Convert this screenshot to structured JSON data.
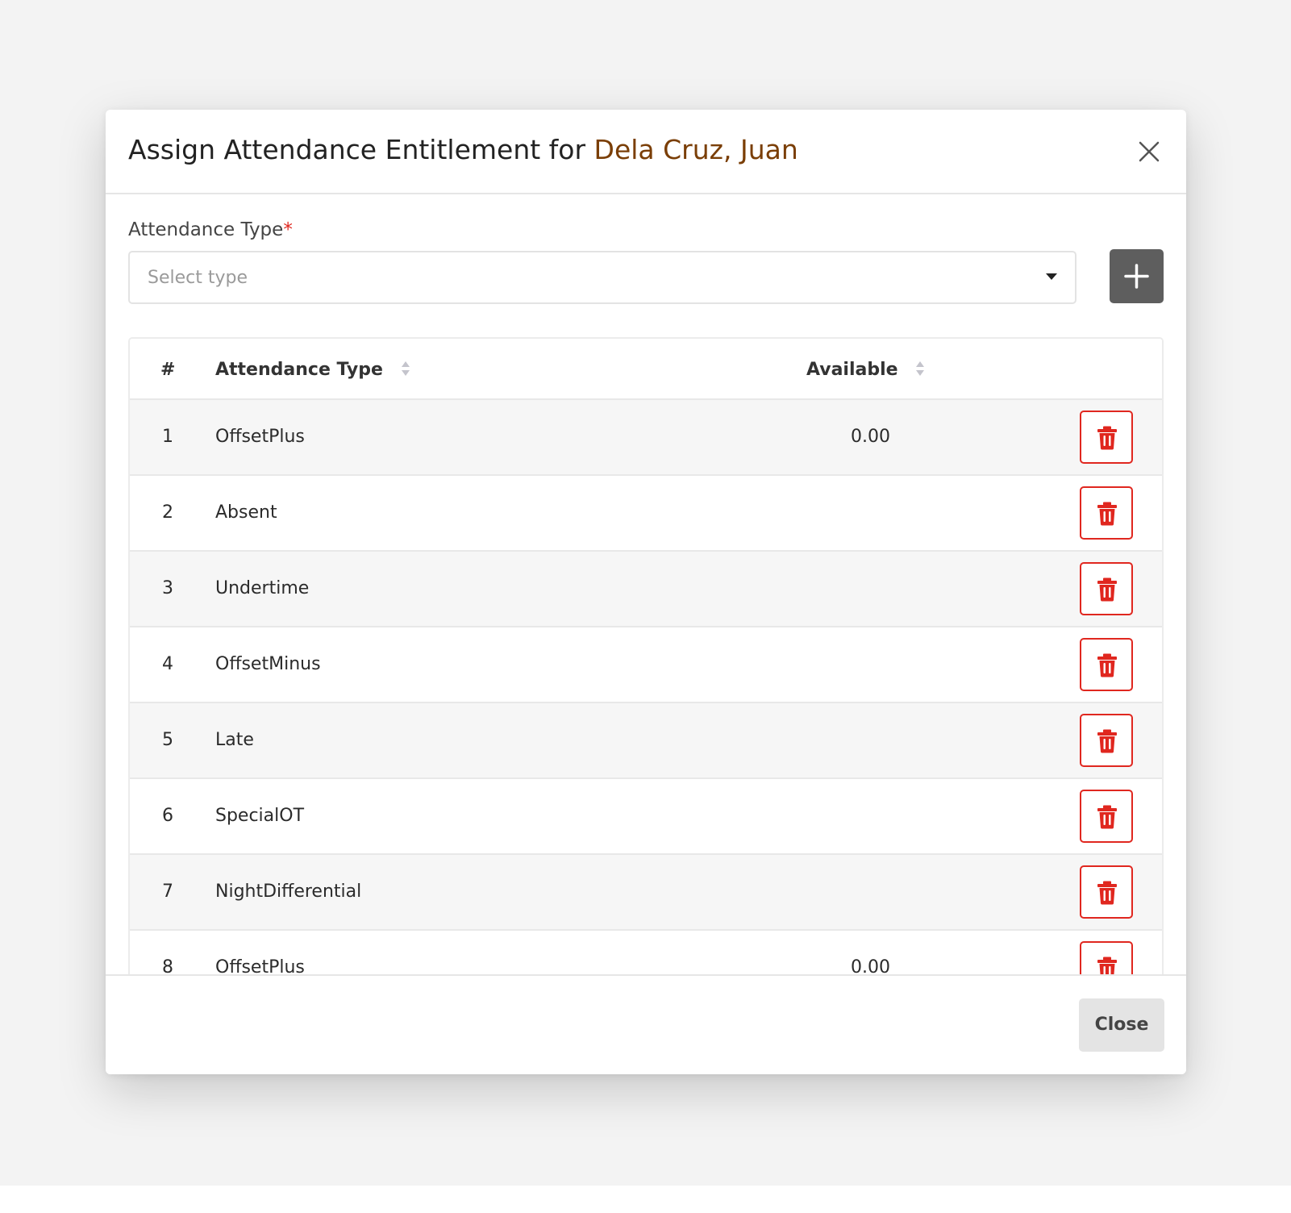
{
  "modal": {
    "title_prefix": "Assign Attendance Entitlement for",
    "employee_name": "Dela Cruz, Juan",
    "accent_color": "#7a3e06"
  },
  "form": {
    "label": "Attendance Type",
    "required_mark": "*",
    "select_placeholder": "Select type"
  },
  "table": {
    "headers": {
      "index": "#",
      "type": "Attendance Type",
      "available": "Available"
    },
    "rows": [
      {
        "index": "1",
        "type": "OffsetPlus",
        "available": "0.00"
      },
      {
        "index": "2",
        "type": "Absent",
        "available": ""
      },
      {
        "index": "3",
        "type": "Undertime",
        "available": ""
      },
      {
        "index": "4",
        "type": "OffsetMinus",
        "available": ""
      },
      {
        "index": "5",
        "type": "Late",
        "available": ""
      },
      {
        "index": "6",
        "type": "SpecialOT",
        "available": ""
      },
      {
        "index": "7",
        "type": "NightDifferential",
        "available": ""
      },
      {
        "index": "8",
        "type": "OffsetPlus",
        "available": "0.00"
      }
    ]
  },
  "footer": {
    "close_label": "Close"
  },
  "icons": {
    "close": "close-icon",
    "add": "plus-icon",
    "delete": "trash-icon",
    "sort": "sort-icon",
    "dropdown": "chevron-down-icon"
  },
  "colors": {
    "danger": "#e0271f",
    "add_button": "#5e5e5e"
  }
}
